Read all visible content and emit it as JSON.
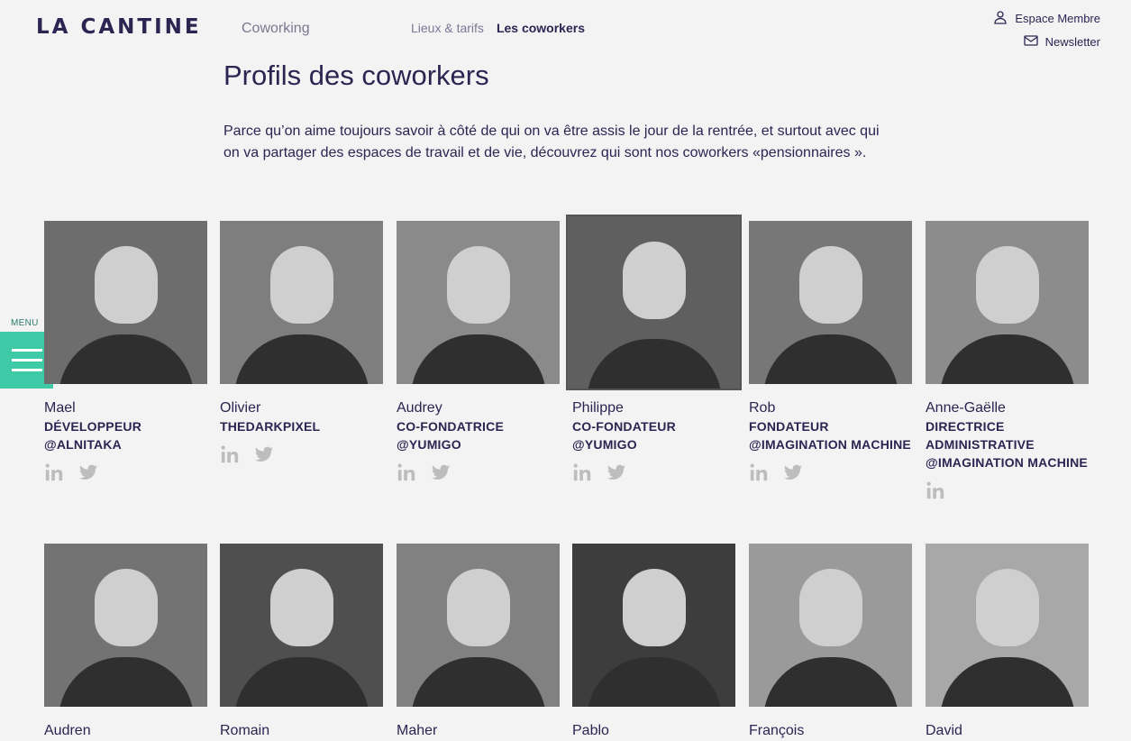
{
  "header": {
    "logo_text": "LA CANTINE",
    "section": "Coworking",
    "nav": [
      {
        "label": "Lieux & tarifs",
        "active": false
      },
      {
        "label": "Les coworkers",
        "active": true
      }
    ],
    "member_space": "Espace Membre",
    "newsletter": "Newsletter"
  },
  "side_menu": {
    "label": "MENU"
  },
  "page": {
    "title": "Profils des coworkers",
    "intro": "Parce qu’on aime toujours savoir à côté de qui on va être assis le jour de la rentrée, et surtout avec qui on va partager des espaces de travail et de vie, découvrez qui sont nos coworkers «pensionnaires »."
  },
  "coworkers": [
    {
      "name": "Mael",
      "role": "Développeur @Alnitaka",
      "linkedin": true,
      "twitter": true
    },
    {
      "name": "Olivier",
      "role": "thedarkpixel",
      "linkedin": true,
      "twitter": true
    },
    {
      "name": "Audrey",
      "role": "Co-fondatrice @Yumigo",
      "linkedin": true,
      "twitter": true
    },
    {
      "name": "Philippe",
      "role": "Co-fondateur @Yumigo",
      "linkedin": true,
      "twitter": true
    },
    {
      "name": "Rob",
      "role": "Fondateur @Imagination Machine",
      "linkedin": true,
      "twitter": true
    },
    {
      "name": "Anne-Gaëlle",
      "role": "Directrice Administrative @Imagination Machine",
      "linkedin": true,
      "twitter": false
    },
    {
      "name": "Audren",
      "role": "",
      "linkedin": false,
      "twitter": false
    },
    {
      "name": "Romain",
      "role": "",
      "linkedin": false,
      "twitter": false
    },
    {
      "name": "Maher",
      "role": "",
      "linkedin": false,
      "twitter": false
    },
    {
      "name": "Pablo",
      "role": "",
      "linkedin": false,
      "twitter": false
    },
    {
      "name": "François",
      "role": "",
      "linkedin": false,
      "twitter": false
    },
    {
      "name": "David",
      "role": "",
      "linkedin": false,
      "twitter": false
    }
  ],
  "icons": {
    "linkedin": "linkedin-icon",
    "twitter": "twitter-icon",
    "user": "user-icon",
    "mail": "mail-icon"
  },
  "colors": {
    "accent": "#3ec9a7",
    "text": "#2d2452",
    "background": "#f3f3f3",
    "social": "#bdbdbd"
  }
}
